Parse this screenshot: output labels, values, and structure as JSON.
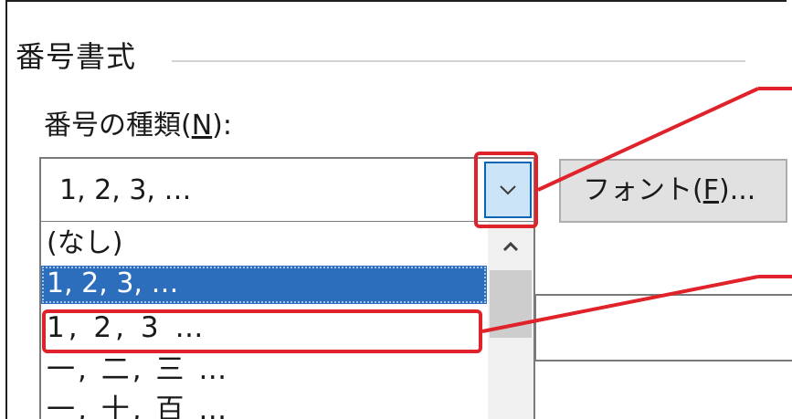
{
  "numbering_group": {
    "title": "番号書式",
    "type_label_prefix": "番号の種類(",
    "type_label_access": "N",
    "type_label_suffix": "):",
    "selected_value": "1, 2, 3, …",
    "font_button_prefix": "フォント(",
    "font_button_access": "F",
    "font_button_suffix": ")..."
  },
  "dropdown": {
    "items": [
      "(なし)",
      "1, 2, 3, …",
      "1, 2, 3 …",
      "一, 二, 三 …",
      "一, 十, 百 …"
    ],
    "selected_index": 1
  },
  "icons": {
    "dropdown_button": "chevron-down-icon",
    "scroll_up": "chevron-up-icon"
  },
  "colors": {
    "highlight": "#2d6ebc",
    "callout": "#e0222a",
    "dropdown_button_bg": "#cce4f7"
  }
}
